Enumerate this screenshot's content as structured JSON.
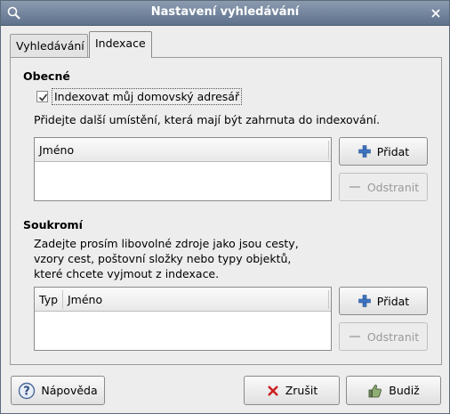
{
  "window": {
    "title": "Nastavení vyhledávání"
  },
  "tabs": [
    {
      "label": "Vyhledávání",
      "active": false
    },
    {
      "label": "Indexace",
      "active": true
    }
  ],
  "general": {
    "title": "Obecné",
    "checkbox_label": "Indexovat můj domovský adresář",
    "checkbox_checked": true,
    "help": "Přidejte další umístění, která mají být zahrnuta do indexování.",
    "list_columns": [
      "Jméno"
    ],
    "add_label": "Přidat",
    "remove_label": "Odstranit"
  },
  "privacy": {
    "title": "Soukromí",
    "help_lines": [
      "Zadejte prosím libovolné zdroje jako jsou cesty,",
      "vzory cest, poštovní složky nebo typy objektů,",
      "které chcete vyjmout z indexace."
    ],
    "list_columns": [
      "Typ",
      "Jméno"
    ],
    "add_label": "Přidat",
    "remove_label": "Odstranit"
  },
  "footer": {
    "help_label": "Nápověda",
    "cancel_label": "Zrušit",
    "ok_label": "Budiž"
  },
  "icons": {
    "title_icon": "search-icon",
    "close": "close-icon",
    "add": "plus-icon",
    "remove": "minus-icon",
    "help": "help-icon",
    "cancel": "cancel-x-icon",
    "ok": "thumbs-up-icon"
  },
  "colors": {
    "titlebar": "#6f8098",
    "add_icon": "#3f74c2",
    "cancel_icon": "#cc2222"
  }
}
